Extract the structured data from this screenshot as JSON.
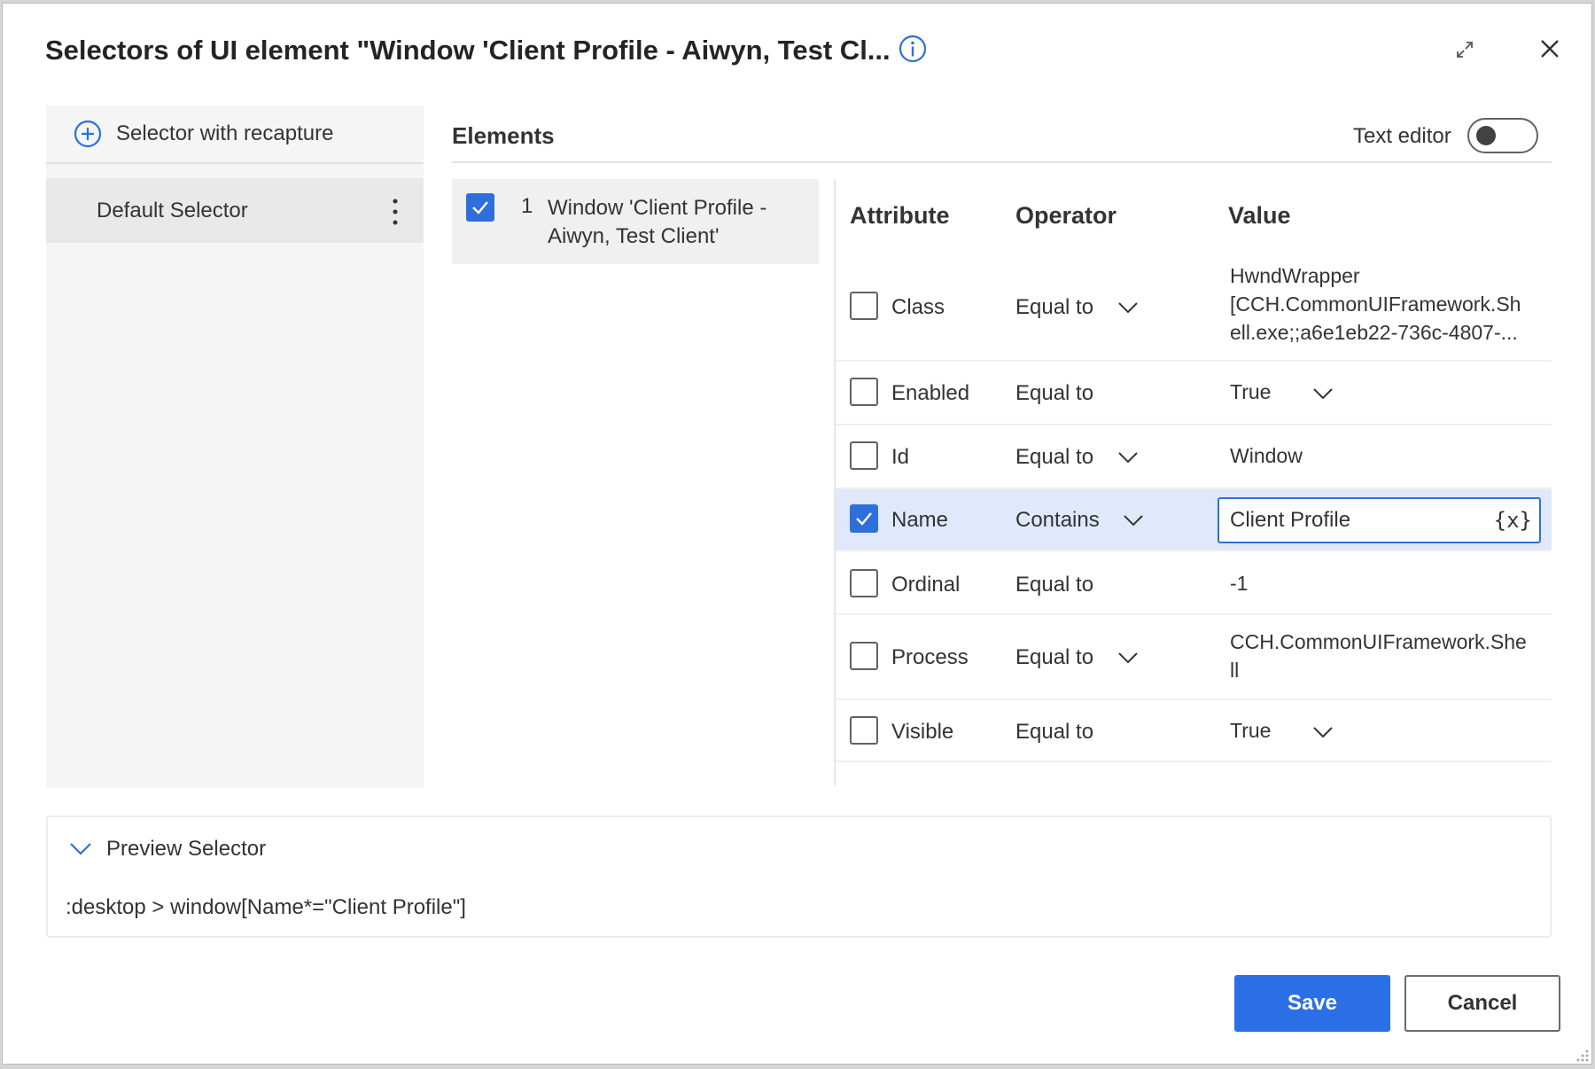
{
  "dialog": {
    "title": "Selectors of UI element \"Window 'Client Profile - Aiwyn, Test Cl...",
    "icons": {
      "info": "info-icon",
      "expand": "expand-icon",
      "close": "close-icon"
    }
  },
  "left_panel": {
    "recapture_label": "Selector with recapture",
    "selectors": [
      {
        "label": "Default Selector"
      }
    ]
  },
  "elements": {
    "title": "Elements",
    "text_editor_label": "Text editor",
    "text_editor_on": false,
    "items": [
      {
        "index": "1",
        "label": "Window 'Client Profile - Aiwyn, Test Client'",
        "checked": true
      }
    ]
  },
  "table": {
    "headers": {
      "attribute": "Attribute",
      "operator": "Operator",
      "value": "Value"
    },
    "rows": [
      {
        "attribute": "Class",
        "operator": "Equal to",
        "value": "HwndWrapper [CCH.CommonUIFramework.Shell.exe;;a6e1eb22-736c-4807-...",
        "value_line1": "HwndWrapper",
        "value_line2": "[CCH.CommonUIFramework.Sh",
        "value_line3": "ell.exe;;a6e1eb22-736c-4807-...",
        "checked": false
      },
      {
        "attribute": "Enabled",
        "operator": "Equal to",
        "value": "True",
        "checked": false
      },
      {
        "attribute": "Id",
        "operator": "Equal to",
        "value": "Window",
        "checked": false
      },
      {
        "attribute": "Name",
        "operator": "Contains",
        "value": "Client Profile",
        "checked": true,
        "variable_icon": "{x}"
      },
      {
        "attribute": "Ordinal",
        "operator": "Equal to",
        "value": "-1",
        "checked": false
      },
      {
        "attribute": "Process",
        "operator": "Equal to",
        "value": "CCH.CommonUIFramework.Shell",
        "value_line1": "CCH.CommonUIFramework.She",
        "value_line2": "ll",
        "checked": false
      },
      {
        "attribute": "Visible",
        "operator": "Equal to",
        "value": "True",
        "checked": false
      }
    ]
  },
  "preview": {
    "label": "Preview Selector",
    "code": ":desktop > window[Name*=\"Client Profile\"]"
  },
  "buttons": {
    "save": "Save",
    "cancel": "Cancel"
  },
  "colors": {
    "accent": "#2a6fe6",
    "selected_row": "#dfe9fb"
  }
}
